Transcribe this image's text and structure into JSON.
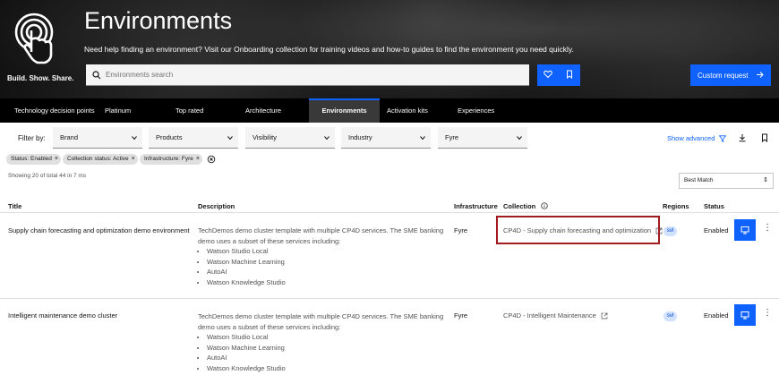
{
  "hero": {
    "logo_text": "Build. Show. Share.",
    "title": "Environments",
    "subtitle": "Need help finding an environment? Visit our Onboarding collection for training videos and how-to guides to find the environment you need quickly.",
    "search_placeholder": "Environments search",
    "custom_request_label": "Custom request"
  },
  "tabs": [
    {
      "label": "Technology decision points",
      "active": false
    },
    {
      "label": "Platinum",
      "active": false
    },
    {
      "label": "Top rated",
      "active": false
    },
    {
      "label": "Architecture",
      "active": false
    },
    {
      "label": "Environments",
      "active": true
    },
    {
      "label": "Activation kits",
      "active": false
    },
    {
      "label": "Experiences",
      "active": false
    }
  ],
  "filters": {
    "label": "Filter by:",
    "selects": [
      "Brand",
      "Products",
      "Visibility",
      "Industry",
      "Fyre"
    ],
    "show_advanced": "Show advanced"
  },
  "tags": [
    "Status: Enabled",
    "Collection status: Active",
    "Infrastructure: Fyre"
  ],
  "results_text": "Showing 20 of total 44 in 7 ms",
  "sort_value": "Best Match",
  "table": {
    "headers": [
      "Title",
      "Description",
      "Infrastructure",
      "Collection",
      "Regions",
      "Status"
    ],
    "rows": [
      {
        "title": "Supply chain forecasting and optimization demo environment",
        "desc_intro": "TechDemos demo cluster template with multiple CP4D services. The SME banking demo uses a subset of these services including:",
        "desc_items": [
          "Watson Studio Local",
          "Watson Machine Learning",
          "AutoAI",
          "Watson Knowledge Studio"
        ],
        "infrastructure": "Fyre",
        "collection": "CP4D - Supply chain forecasting and optimization",
        "region": "svl",
        "status": "Enabled"
      },
      {
        "title": "Intelligent maintenance demo cluster",
        "desc_intro": "TechDemos demo cluster template with multiple CP4D services. The SME banking demo uses a subset of these services including:",
        "desc_items": [
          "Watson Studio Local",
          "Watson Machine Learning",
          "AutoAI",
          "Watson Knowledge Studio"
        ],
        "infrastructure": "Fyre",
        "collection": "CP4D - Intelligent Maintenance",
        "region": "svl",
        "status": "Enabled"
      }
    ]
  },
  "colors": {
    "accent": "#0f62fe",
    "highlight_border": "#a2191f",
    "tag_bg": "#e0e0e0"
  }
}
